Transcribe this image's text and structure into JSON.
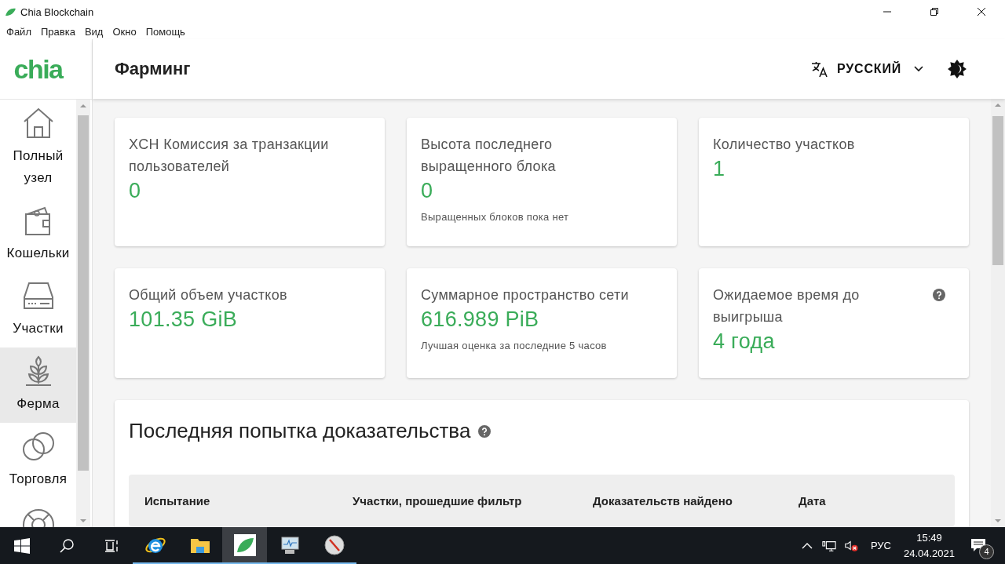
{
  "window": {
    "title": "Chia Blockchain"
  },
  "menu": [
    "Файл",
    "Правка",
    "Вид",
    "Окно",
    "Помощь"
  ],
  "header": {
    "logo": "chia",
    "title": "Фарминг",
    "language": "РУССКИЙ"
  },
  "sidebar": {
    "items": [
      {
        "kind": "home",
        "label": "Полный узел",
        "selected": false
      },
      {
        "kind": "wallet",
        "label": "Кошельки",
        "selected": false
      },
      {
        "kind": "drive",
        "label": "Участки",
        "selected": false
      },
      {
        "kind": "farm",
        "label": "Ферма",
        "selected": true
      },
      {
        "kind": "trade",
        "label": "Торговля",
        "selected": false
      },
      {
        "kind": "support",
        "selected": false
      }
    ]
  },
  "cards": [
    {
      "title": "XCH Комиссия за транзакции пользователей",
      "value": "0",
      "help": false
    },
    {
      "title": "Высота последнего выращенного блока",
      "value": "0",
      "note": "Выращенных блоков пока нет",
      "help": false
    },
    {
      "title": "Количество участков",
      "value": "1",
      "help": false
    },
    {
      "title": "Общий объем участков",
      "value": "101.35 GiB",
      "help": false
    },
    {
      "title": "Суммарное пространство сети",
      "value": "616.989 PiB",
      "note": "Лучшая оценка за последние 5 часов",
      "help": false
    },
    {
      "title": "Ожидаемое время до выигрыша",
      "value": "4 года",
      "help": true
    }
  ],
  "proofs": {
    "title": "Последняя попытка доказательства",
    "help": true,
    "table": {
      "columns": [
        "Испытание",
        "Участки, прошедшие фильтр",
        "Доказательств найдено",
        "Дата"
      ]
    }
  },
  "taskbar": {
    "apps": [
      {
        "kind": "browser",
        "selected": false
      },
      {
        "kind": "folder",
        "selected": false
      },
      {
        "kind": "chia",
        "selected": true
      },
      {
        "kind": "monitor",
        "selected": false
      },
      {
        "kind": "compass",
        "selected": false
      }
    ],
    "language": "РУС",
    "time": "15:49",
    "date": "24.04.2021",
    "notifications": "4"
  }
}
